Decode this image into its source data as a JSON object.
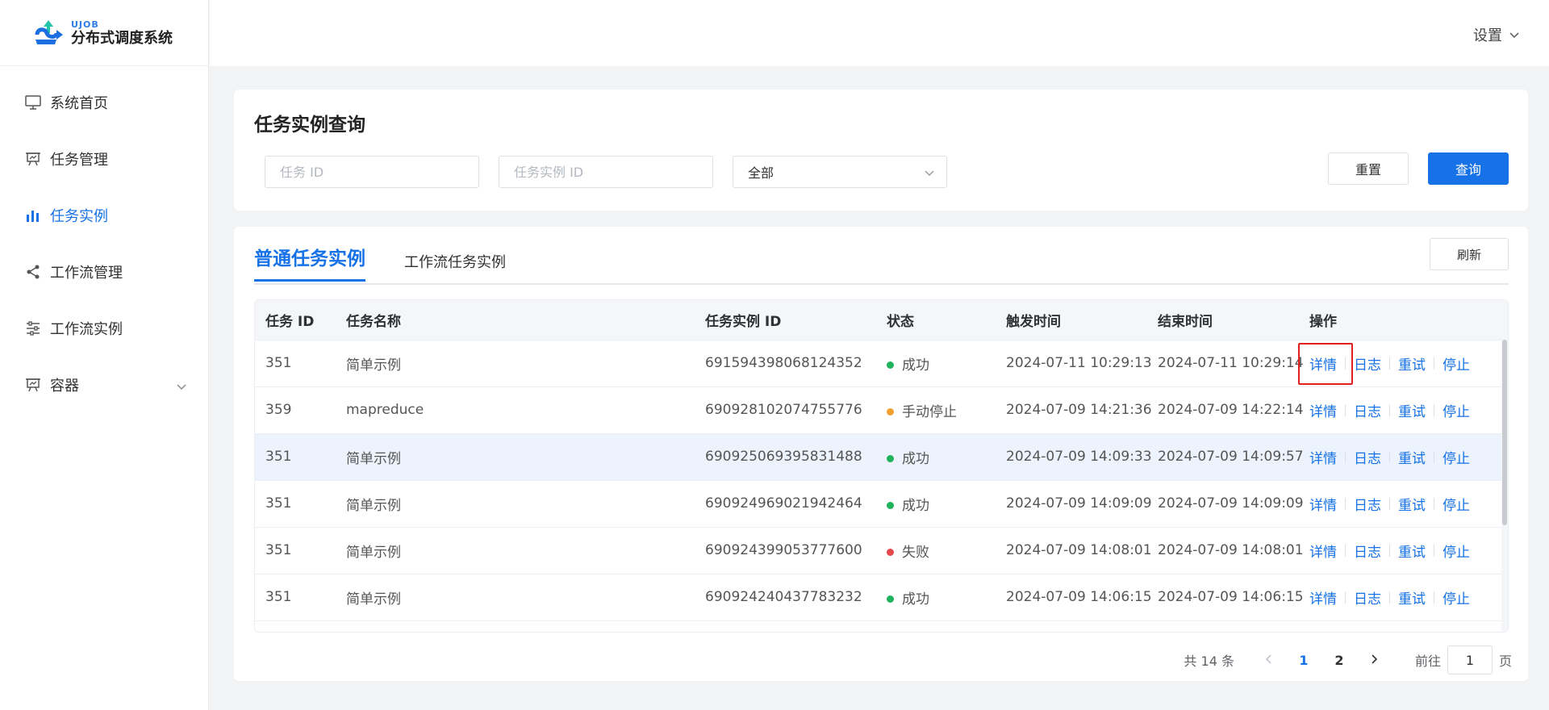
{
  "app": {
    "logo_small": "UJOB",
    "logo_title": "分布式调度系统"
  },
  "sidebar": {
    "items": [
      {
        "label": "系统首页",
        "icon": "monitor-icon"
      },
      {
        "label": "任务管理",
        "icon": "presentation-icon"
      },
      {
        "label": "任务实例",
        "icon": "bar-chart-icon",
        "active": true
      },
      {
        "label": "工作流管理",
        "icon": "share-icon"
      },
      {
        "label": "工作流实例",
        "icon": "sliders-icon"
      },
      {
        "label": "容器",
        "icon": "presentation-icon",
        "expandable": true
      }
    ]
  },
  "header": {
    "settings_label": "设置"
  },
  "query": {
    "title": "任务实例查询",
    "job_id_placeholder": "任务 ID",
    "instance_id_placeholder": "任务实例 ID",
    "status_value": "全部",
    "reset_label": "重置",
    "search_label": "查询"
  },
  "tabs": {
    "normal": "普通任务实例",
    "workflow": "工作流任务实例",
    "refresh_label": "刷新"
  },
  "table": {
    "columns": [
      "任务 ID",
      "任务名称",
      "任务实例 ID",
      "状态",
      "触发时间",
      "结束时间",
      "操作"
    ],
    "ops": [
      "详情",
      "日志",
      "重试",
      "停止"
    ],
    "rows": [
      {
        "job_id": "351",
        "name": "简单示例",
        "instance_id": "691594398068124352",
        "status": "成功",
        "status_color": "#20b25c",
        "trigger": "2024-07-11 10:29:13",
        "end": "2024-07-11 10:29:14"
      },
      {
        "job_id": "359",
        "name": "mapreduce",
        "instance_id": "690928102074755776",
        "status": "手动停止",
        "status_color": "#f0a030",
        "trigger": "2024-07-09 14:21:36",
        "end": "2024-07-09 14:22:14"
      },
      {
        "job_id": "351",
        "name": "简单示例",
        "instance_id": "690925069395831488",
        "status": "成功",
        "status_color": "#20b25c",
        "trigger": "2024-07-09 14:09:33",
        "end": "2024-07-09 14:09:57"
      },
      {
        "job_id": "351",
        "name": "简单示例",
        "instance_id": "690924969021942464",
        "status": "成功",
        "status_color": "#20b25c",
        "trigger": "2024-07-09 14:09:09",
        "end": "2024-07-09 14:09:09"
      },
      {
        "job_id": "351",
        "name": "简单示例",
        "instance_id": "690924399053777600",
        "status": "失败",
        "status_color": "#e5484d",
        "trigger": "2024-07-09 14:08:01",
        "end": "2024-07-09 14:08:01"
      },
      {
        "job_id": "351",
        "name": "简单示例",
        "instance_id": "690924240437783232",
        "status": "成功",
        "status_color": "#20b25c",
        "trigger": "2024-07-09 14:06:15",
        "end": "2024-07-09 14:06:15"
      }
    ]
  },
  "pagination": {
    "total_text": "共 14 条",
    "pages": [
      "1",
      "2"
    ],
    "current_page": "1",
    "goto_prefix": "前往",
    "goto_value": "1",
    "goto_suffix": "页"
  },
  "colors": {
    "accent": "#1672e6",
    "success": "#20b25c",
    "warning": "#f0a030",
    "danger": "#e5484d"
  }
}
